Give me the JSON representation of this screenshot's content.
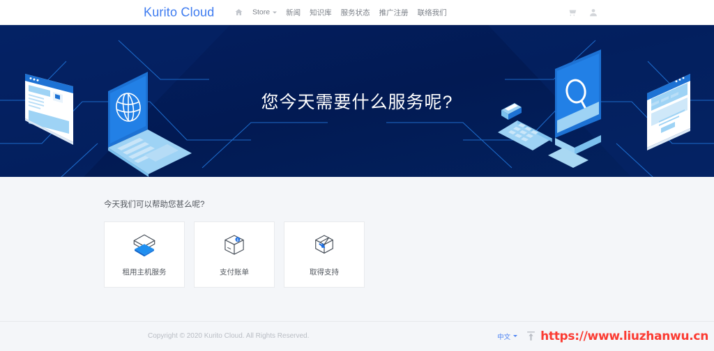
{
  "header": {
    "brand": "Kurito Cloud",
    "nav": [
      {
        "label": "",
        "icon": "home-icon",
        "name": "nav-home"
      },
      {
        "label": "Store",
        "icon": "chevron-down-icon",
        "name": "nav-store"
      },
      {
        "label": "新闻",
        "icon": "",
        "name": "nav-news"
      },
      {
        "label": "知识库",
        "icon": "",
        "name": "nav-knowledgebase"
      },
      {
        "label": "服务状态",
        "icon": "",
        "name": "nav-service-status"
      },
      {
        "label": "推广注册",
        "icon": "",
        "name": "nav-affiliate"
      },
      {
        "label": "联络我们",
        "icon": "",
        "name": "nav-contact"
      }
    ],
    "cart_icon": "shopping-cart-icon",
    "account_icon": "user-account-icon"
  },
  "hero": {
    "title": "您今天需要什么服务呢?",
    "bg_color": "#031e5e",
    "accent_color": "#1d72d4",
    "left_art": "isometric-browser-window-and-laptop-with-globe",
    "right_art": "isometric-desktop-monitor-with-search-keyboard-phone-and-browser-window"
  },
  "main": {
    "section_title": "今天我们可以帮助您甚么呢?",
    "cards": [
      {
        "label": "租用主机服务",
        "icon": "order-box-icon",
        "name": "card-order-hosting"
      },
      {
        "label": "支付账单",
        "icon": "billing-box-icon",
        "name": "card-pay-bill"
      },
      {
        "label": "取得支持",
        "icon": "support-box-icon",
        "name": "card-get-support"
      }
    ]
  },
  "footer": {
    "copyright": "Copyright © 2020 Kurito Cloud. All Rights Reserved.",
    "language": "中文",
    "language_icon": "chevron-down-icon",
    "watermark_icon": "upload-arrow-icon",
    "watermark_text": "https://www.liuzhanwu.cn",
    "watermark_color": "#fb3b32"
  }
}
